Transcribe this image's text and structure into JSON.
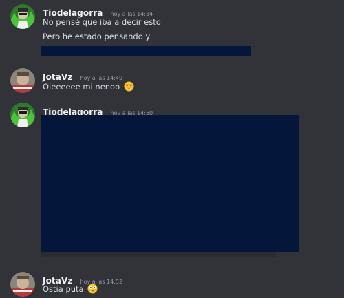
{
  "colors": {
    "background": "#313338",
    "username": "#f2f3f5",
    "timestamp": "#949ba4",
    "message_text": "#dbdee1",
    "redacted_block": "#04163a"
  },
  "messages": [
    {
      "username": "Tiodelagorra",
      "timestamp": "hoy a las 14:34",
      "avatar_icon": "green-avatar-icon",
      "lines": [
        "No pensé que iba a decir esto",
        "Pero he estado pensando y"
      ]
    },
    {
      "username": "JotaVz",
      "timestamp": "hoy a las 14:49",
      "avatar_icon": "blurry-avatar-icon",
      "text": "Oleeeeee mi nenoo",
      "emoji": "star-struck-emoji-icon"
    },
    {
      "username": "Tiodelagorra",
      "timestamp": "hoy a las 14:50",
      "avatar_icon": "green-avatar-icon"
    },
    {
      "username": "JotaVz",
      "timestamp": "hoy a las 14:52",
      "avatar_icon": "blurry-avatar-icon",
      "text": "Ostia puta",
      "emoji": "flushed-face-emoji-icon"
    }
  ]
}
